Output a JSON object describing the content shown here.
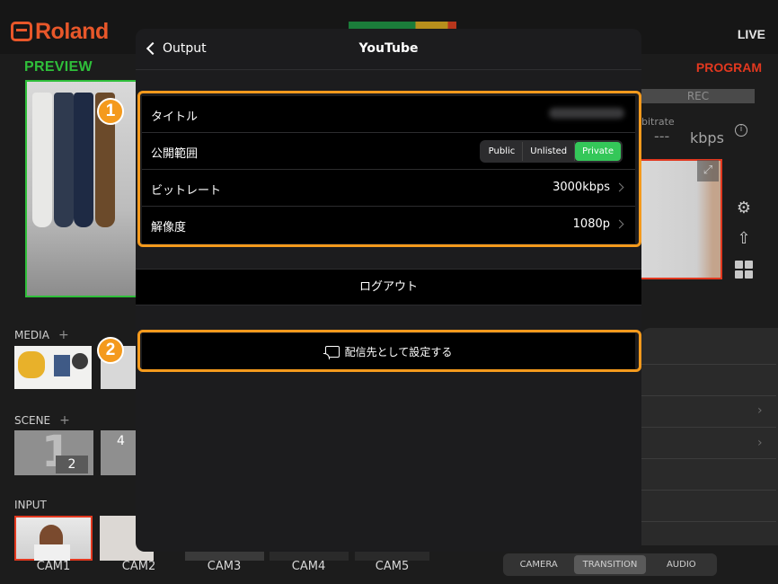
{
  "app": {
    "brand": "Roland",
    "status": "LIVE",
    "preview_label": "PREVIEW",
    "program_label": "PROGRAM",
    "rec_label": "REC",
    "bitrate_label": "bitrate",
    "bitrate_value": "---",
    "bitrate_unit": "kbps"
  },
  "sections": {
    "media": "MEDIA",
    "scene": "SCENE",
    "input": "INPUT",
    "plus": "+"
  },
  "scenes": [
    {
      "big": "1",
      "small": "2"
    },
    {
      "big": "",
      "small": "4"
    }
  ],
  "inputs": [
    "CAM1",
    "CAM2",
    "CAM3",
    "CAM4",
    "CAM5"
  ],
  "bottom_tabs": {
    "items": [
      "CAMERA",
      "TRANSITION",
      "AUDIO"
    ],
    "selected": "TRANSITION"
  },
  "modal": {
    "back_label": "Output",
    "title": "YouTube",
    "rows": {
      "title_label": "タイトル",
      "privacy_label": "公開範囲",
      "privacy_options": [
        "Public",
        "Unlisted",
        "Private"
      ],
      "privacy_selected": "Private",
      "bitrate_label": "ビットレート",
      "bitrate_value": "3000kbps",
      "resolution_label": "解像度",
      "resolution_value": "1080p"
    },
    "logout_label": "ログアウト",
    "set_destination_label": "配信先として設定する"
  },
  "annotations": [
    "1",
    "2"
  ],
  "colors": {
    "accent_orange": "#f49a1d",
    "preview_green": "#2fbf3a",
    "program_red": "#e2381f",
    "toggle_green": "#34c759",
    "brand_orange": "#e8572a"
  }
}
